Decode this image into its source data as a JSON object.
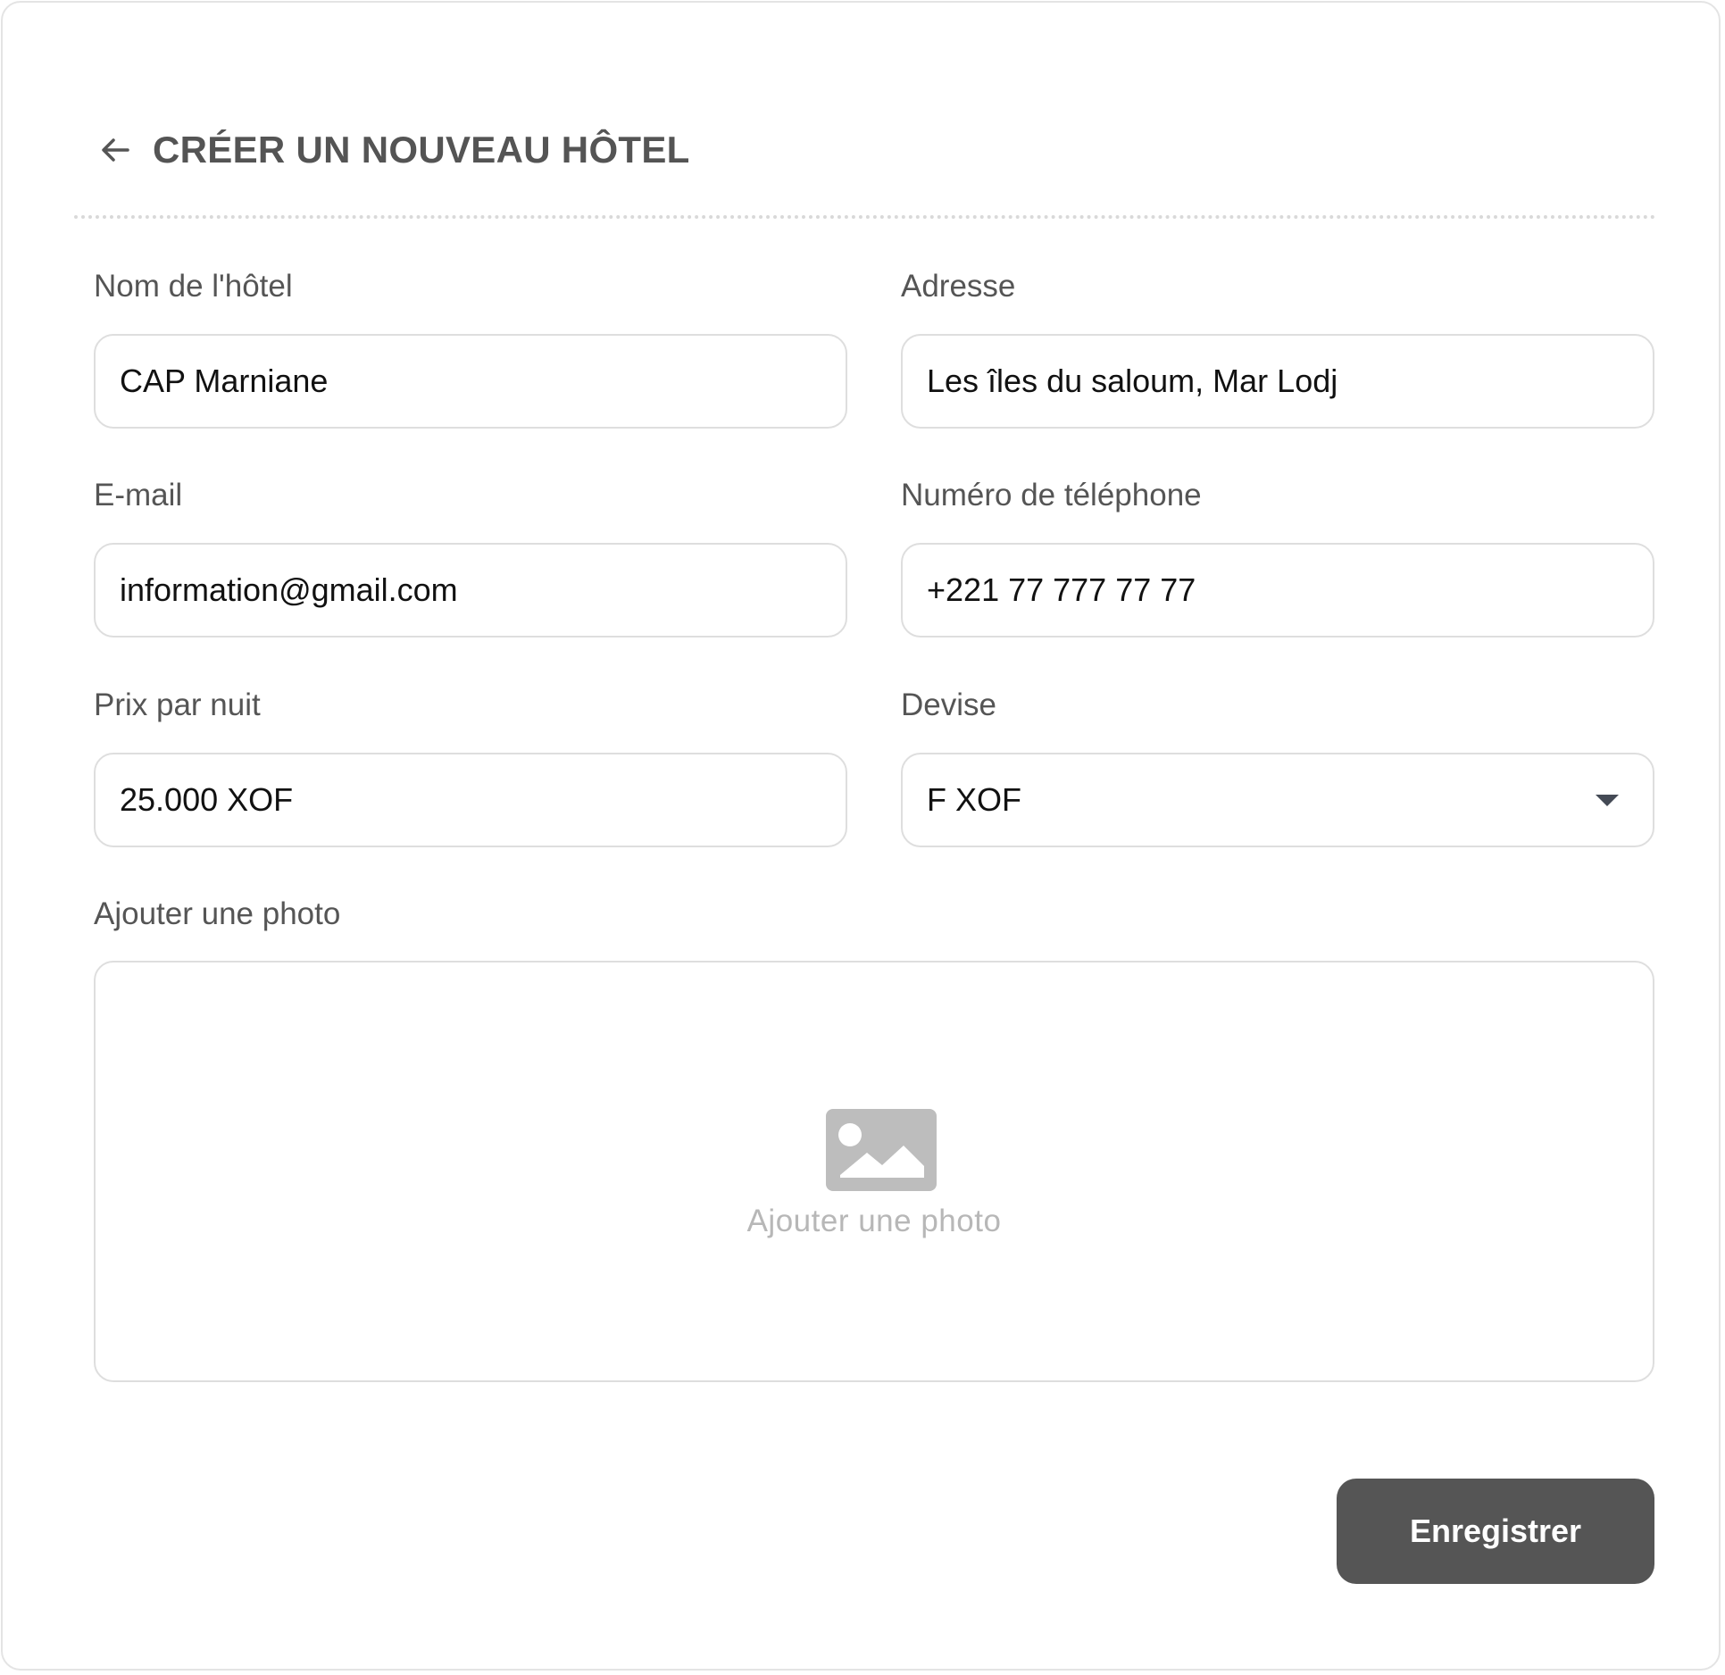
{
  "header": {
    "back_icon": "arrow-left-icon",
    "title": "CRÉER UN NOUVEAU HÔTEL"
  },
  "form": {
    "hotel_name": {
      "label": "Nom de l'hôtel",
      "value": "CAP Marniane"
    },
    "address": {
      "label": "Adresse",
      "value": "Les îles du saloum, Mar Lodj"
    },
    "email": {
      "label": "E-mail",
      "value": "information@gmail.com"
    },
    "phone": {
      "label": "Numéro de téléphone",
      "value": "+221 77 777 77 77"
    },
    "price": {
      "label": "Prix par nuit",
      "value": "25.000 XOF"
    },
    "currency": {
      "label": "Devise",
      "value": "F XOF",
      "icon": "caret-down-icon"
    },
    "photo": {
      "label": "Ajouter une photo",
      "placeholder": "Ajouter une photo",
      "icon": "image-icon"
    }
  },
  "actions": {
    "save_label": "Enregistrer"
  },
  "colors": {
    "title": "#545454",
    "label": "#555555",
    "input_text": "#111111",
    "border": "#dedede",
    "placeholder": "#b7b7b7",
    "button_bg": "#555555",
    "button_text": "#ffffff"
  }
}
